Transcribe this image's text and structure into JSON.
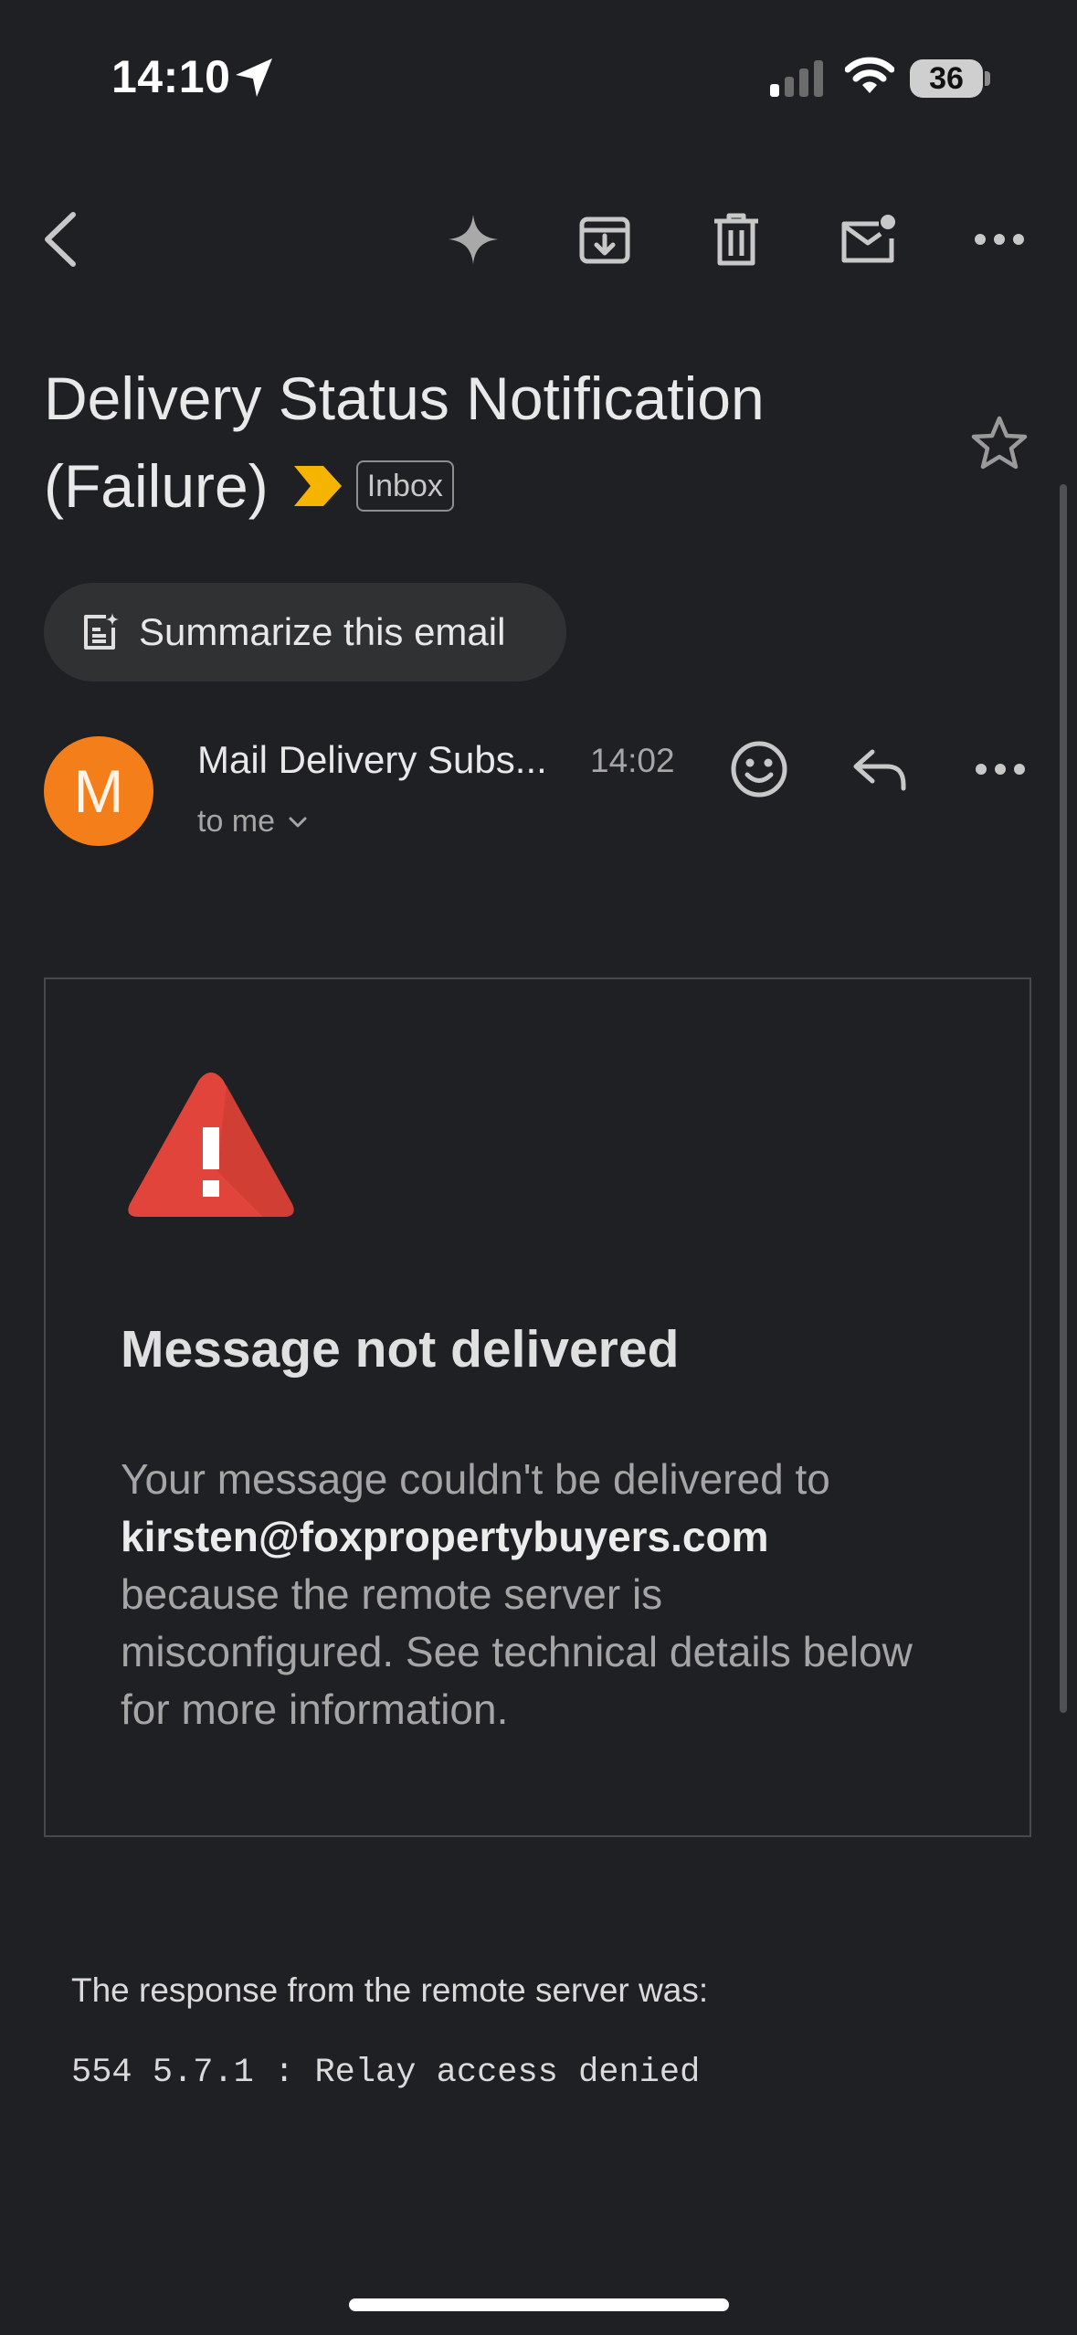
{
  "status_bar": {
    "time": "14:10",
    "battery": "36",
    "icons": [
      "location-arrow-icon",
      "cellular-signal-icon",
      "wifi-icon",
      "battery-icon"
    ]
  },
  "toolbar": {
    "icons": [
      "back-chevron-icon",
      "gemini-sparkle-icon",
      "archive-icon",
      "trash-icon",
      "mark-unread-icon",
      "more-horizontal-icon"
    ]
  },
  "email": {
    "subject_line1": "Delivery Status Notification",
    "subject_line2": "(Failure)",
    "label": "Inbox",
    "importance_color": "#f5b400",
    "summarize_label": "Summarize this email",
    "sender_initial": "M",
    "sender_name": "Mail Delivery Subs...",
    "time": "14:02",
    "recipient": "to me",
    "avatar_color": "#f47f1a"
  },
  "bounce_card": {
    "title": "Message not delivered",
    "body_before": "Your message couldn't be delivered to",
    "address": "kirsten@foxpropertybuyers.com",
    "body_after": "because the remote server is misconfigured. See technical details below for more information.",
    "warning_color": "#e0443a"
  },
  "details": {
    "response_label": "The response from the remote server was:",
    "response_code": "554 5.7.1 : Relay access denied"
  }
}
